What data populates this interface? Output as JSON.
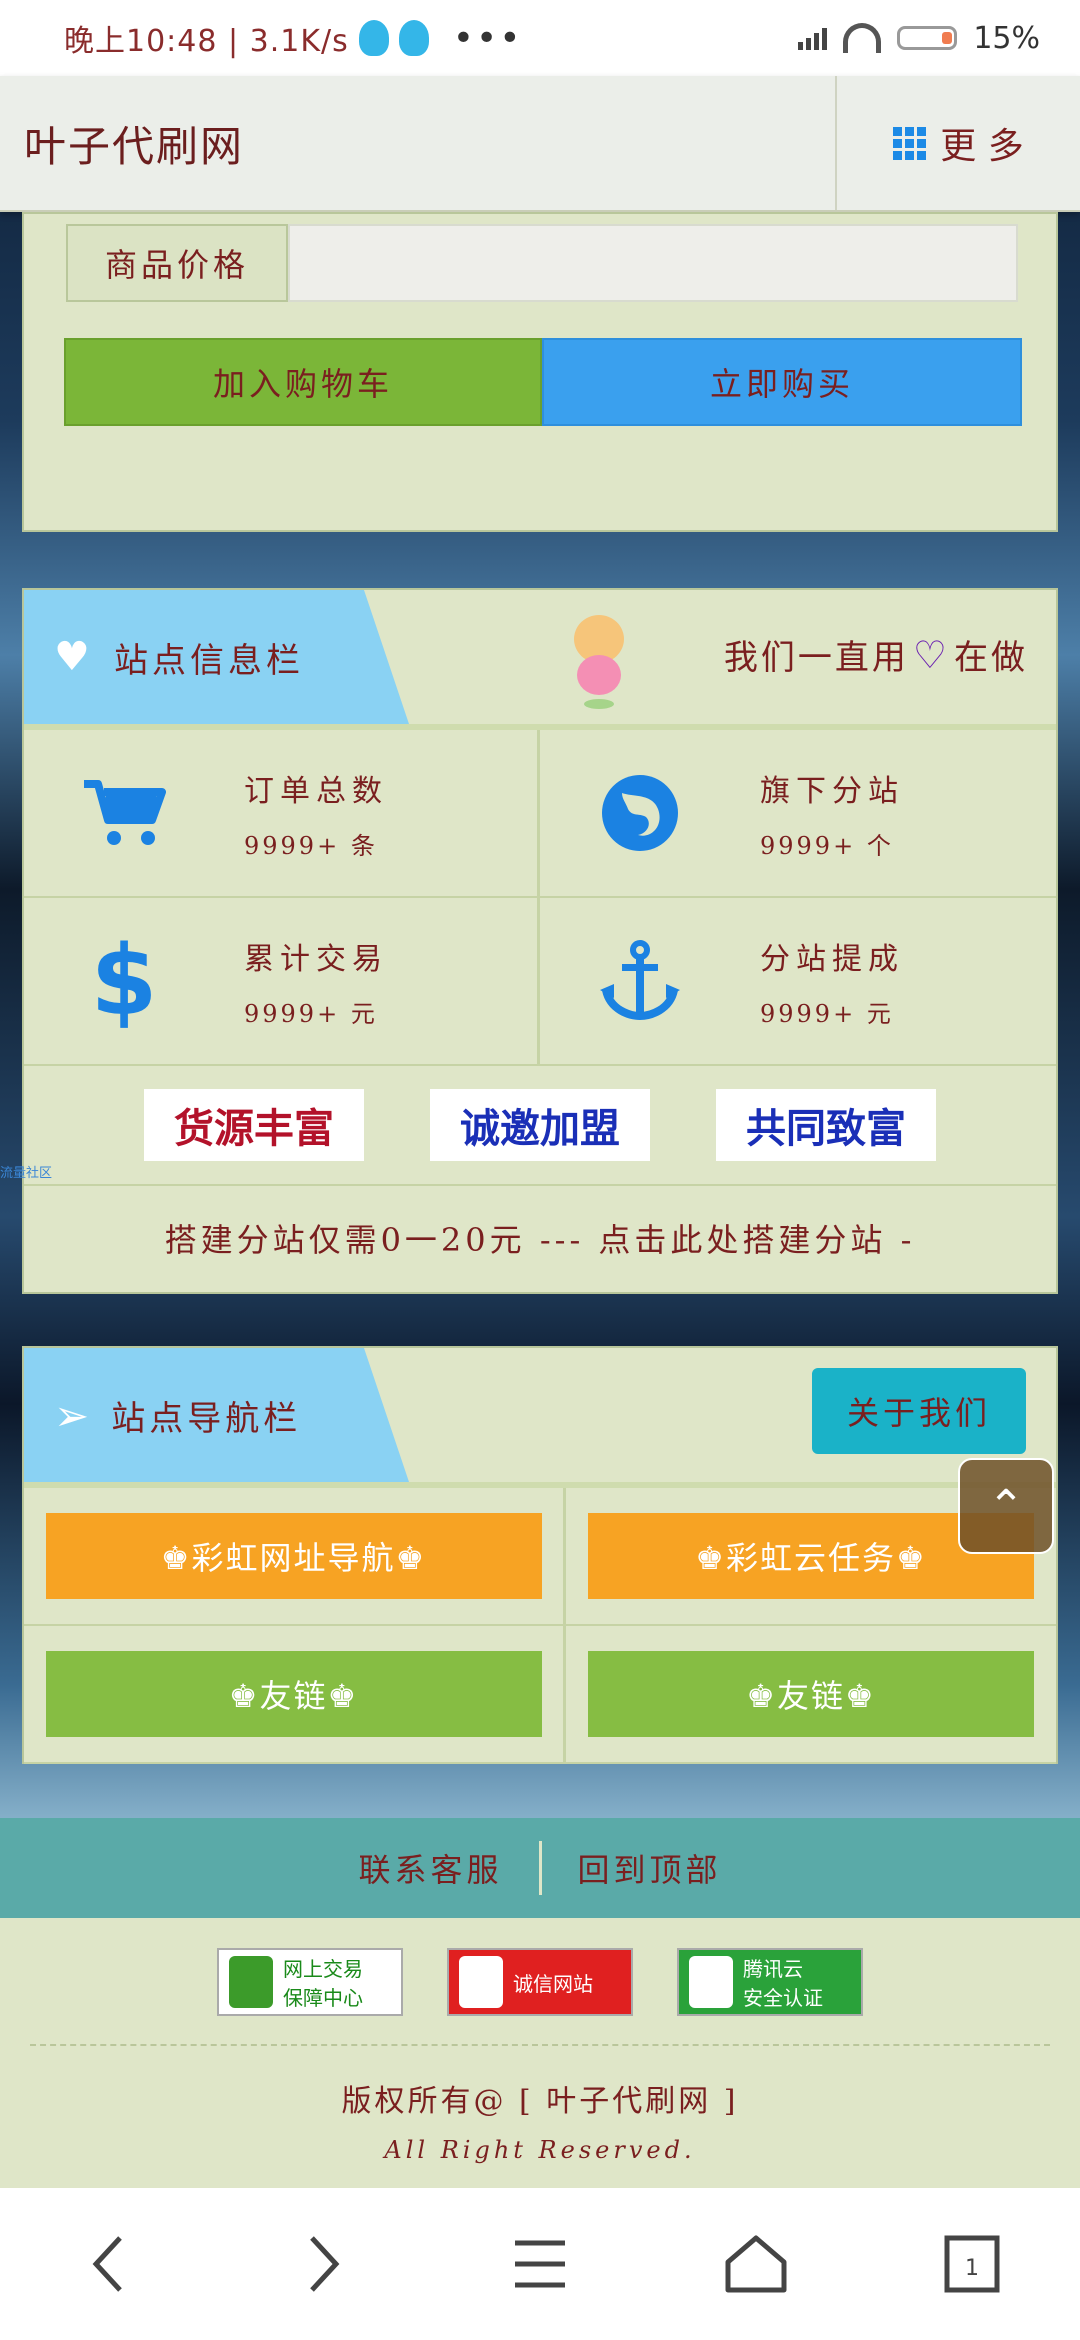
{
  "statusbar": {
    "time": "晚上10:48 | 3.1K/s",
    "dots": "•••",
    "battery": "15%"
  },
  "header": {
    "brand": "叶子代刷网",
    "more_label": "更 多"
  },
  "product": {
    "price_label": "商品价格",
    "price_value": "",
    "add_cart_label": "加入购物车",
    "buy_now_label": "立即购买"
  },
  "site_info": {
    "title": "站点信息栏",
    "slogan_a": "我们一直用",
    "slogan_b": "在做",
    "stats": [
      {
        "label": "订单总数",
        "value": "9999+ 条",
        "icon": "cart-icon"
      },
      {
        "label": "旗下分站",
        "value": "9999+ 个",
        "icon": "firefox-icon"
      },
      {
        "label": "累计交易",
        "value": "9999+ 元",
        "icon": "dollar-icon"
      },
      {
        "label": "分站提成",
        "value": "9999+ 元",
        "icon": "anchor-icon"
      }
    ],
    "badges": [
      "货源丰富",
      "诚邀加盟",
      "共同致富"
    ],
    "build_text": "搭建分站仅需0一20元 --- 点击此处搭建分站 -"
  },
  "side_link": "流量社区",
  "site_nav": {
    "title": "站点导航栏",
    "about_label": "关于我们",
    "items": [
      "♚彩虹网址导航♚",
      "♚彩虹云任务♚",
      "♚友链♚",
      "♚友链♚"
    ]
  },
  "footer": {
    "contact_label": "联系客服",
    "back_top_label": "回到顶部",
    "certs": [
      {
        "line1": "网上交易",
        "line2": "保障中心"
      },
      {
        "line1": "诚信网站",
        "line2": ""
      },
      {
        "line1": "腾讯云",
        "line2": "安全认证"
      }
    ],
    "copyright": "版权所有@ [ 叶子代刷网 ]",
    "rights": "All Right Reserved."
  },
  "colors": {
    "accent_blue": "#3aa0ee",
    "accent_green": "#7bb638",
    "accent_orange": "#f7a323",
    "card_bg": "#dfe6c8",
    "text_maroon": "#7a1f1f"
  }
}
